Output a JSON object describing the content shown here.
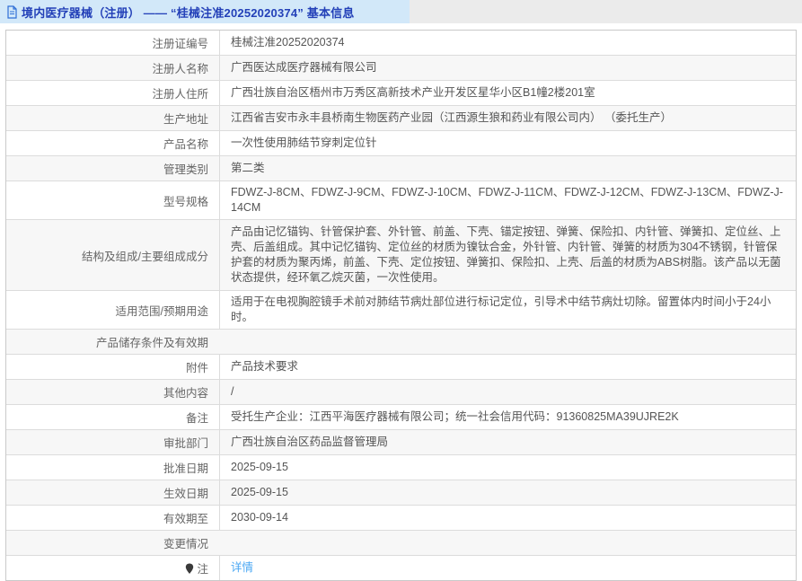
{
  "header": {
    "title": "境内医疗器械（注册） —— “桂械注准20252020374” 基本信息",
    "icon": "document-icon"
  },
  "colors": {
    "header_highlight": "#d2e8f9",
    "header_bar": "#ebebeb",
    "title_text": "#2340b8",
    "alt_row": "#f7f7f7",
    "table_border": "#c9c9c9",
    "row_divider": "#dcdcdc",
    "label_text": "#666666",
    "value_text": "#555555",
    "link": "#4aa7f3"
  },
  "table": {
    "rows": [
      {
        "label": "注册证编号",
        "value": "桂械注准20252020374"
      },
      {
        "label": "注册人名称",
        "value": "广西医达成医疗器械有限公司"
      },
      {
        "label": "注册人住所",
        "value": "广西壮族自治区梧州市万秀区高新技术产业开发区星华小区B1幢2楼201室"
      },
      {
        "label": "生产地址",
        "value": "江西省吉安市永丰县桥南生物医药产业园（江西源生狼和药业有限公司内） （委托生产）"
      },
      {
        "label": "产品名称",
        "value": "一次性使用肺结节穿刺定位针"
      },
      {
        "label": "管理类别",
        "value": "第二类"
      },
      {
        "label": "型号规格",
        "value": "FDWZ-J-8CM、FDWZ-J-9CM、FDWZ-J-10CM、FDWZ-J-11CM、FDWZ-J-12CM、FDWZ-J-13CM、FDWZ-J-14CM"
      },
      {
        "label": "结构及组成/主要组成成分",
        "value": "产品由记忆锚钩、针管保护套、外针管、前盖、下壳、锚定按钮、弹簧、保险扣、内针管、弹簧扣、定位丝、上壳、后盖组成。其中记忆锚钩、定位丝的材质为镍钛合金，外针管、内针管、弹簧的材质为304不锈钢，针管保护套的材质为聚丙烯，前盖、下壳、定位按钮、弹簧扣、保险扣、上壳、后盖的材质为ABS树脂。该产品以无菌状态提供，经环氧乙烷灭菌，一次性使用。",
        "multiline": true
      },
      {
        "label": "适用范围/预期用途",
        "value": "适用于在电视胸腔镜手术前对肺结节病灶部位进行标记定位，引导术中结节病灶切除。留置体内时间小于24小时。"
      },
      {
        "label": "产品储存条件及有效期",
        "value": "",
        "no_divider": true
      },
      {
        "label": "附件",
        "value": "产品技术要求"
      },
      {
        "label": "其他内容",
        "value": "/"
      },
      {
        "label": "备注",
        "value": "受托生产企业：江西平海医疗器械有限公司；统一社会信用代码：91360825MA39UJRE2K"
      },
      {
        "label": "审批部门",
        "value": "广西壮族自治区药品监督管理局"
      },
      {
        "label": "批准日期",
        "value": "2025-09-15"
      },
      {
        "label": "生效日期",
        "value": "2025-09-15"
      },
      {
        "label": "有效期至",
        "value": "2030-09-14"
      },
      {
        "label": "变更情况",
        "value": "",
        "no_divider": true
      },
      {
        "label": "注",
        "value": "详情",
        "link": true,
        "icon": "note-icon"
      }
    ]
  }
}
